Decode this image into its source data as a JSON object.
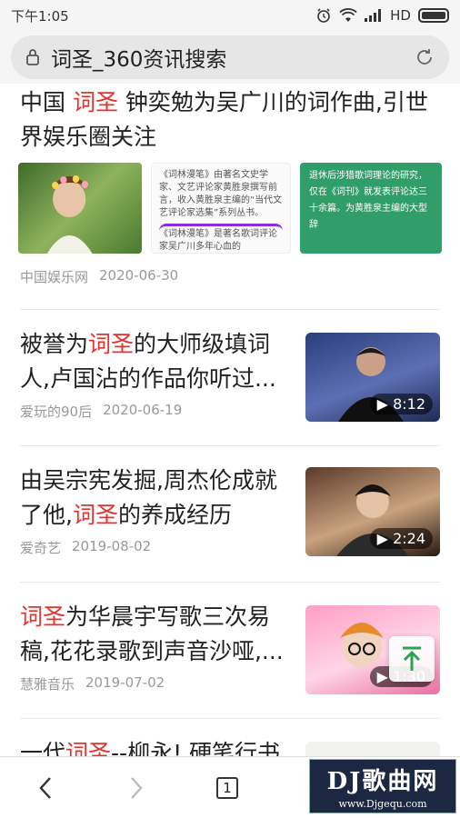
{
  "status": {
    "time": "下午1:05",
    "network": "HD"
  },
  "address_bar": {
    "title": "词圣_360资讯搜索"
  },
  "articles": [
    {
      "title_pre": "中国 ",
      "title_hl": "词圣",
      "title_post": " 钟奕勉为吴广川的词作曲,引世界娱乐圈关注",
      "source": "中国娱乐网",
      "date": "2020-06-30",
      "thumb2_text": "《词林漫笔》由著名文史学家、文艺评论家黄胜泉撰写前言，收入黄胜泉主编的“当代文艺评论家选集”系列丛书。",
      "thumb2_text_b": "《词林漫笔》是著名歌词评论家吴广川多年心血的",
      "thumb3_text": "退休后涉猎歌词理论的研究，仅在《词刊》就发表评论达三十余篇。为黄胜泉主编的大型辞"
    },
    {
      "title_pre": "被誉为",
      "title_hl": "词圣",
      "title_post": "的大师级填词人,卢国沾的作品你听过...",
      "source": "爱玩的90后",
      "date": "2020-06-19",
      "duration": "8:12"
    },
    {
      "title_pre": "由吴宗宪发掘,周杰伦成就了他,",
      "title_hl": "词圣",
      "title_post": "的养成经历",
      "source": "爱奇艺",
      "date": "2019-08-02",
      "duration": "2:24"
    },
    {
      "title_pre": "",
      "title_hl": "词圣",
      "title_post": "为华晨宇写歌三次易稿,花花录歌到声音沙哑,...",
      "source": "慧雅音乐",
      "date": "2019-07-02",
      "duration": "1:30"
    },
    {
      "title_pre": "一代",
      "title_hl": "词圣",
      "title_post": "--柳永! 硬笔行书"
    }
  ],
  "nav": {
    "tab_count": "1"
  },
  "watermark": {
    "big": "DJ歌曲网",
    "small": "www.Djgequ.com"
  },
  "colors": {
    "highlight": "#e5322d",
    "meta": "#999999"
  }
}
